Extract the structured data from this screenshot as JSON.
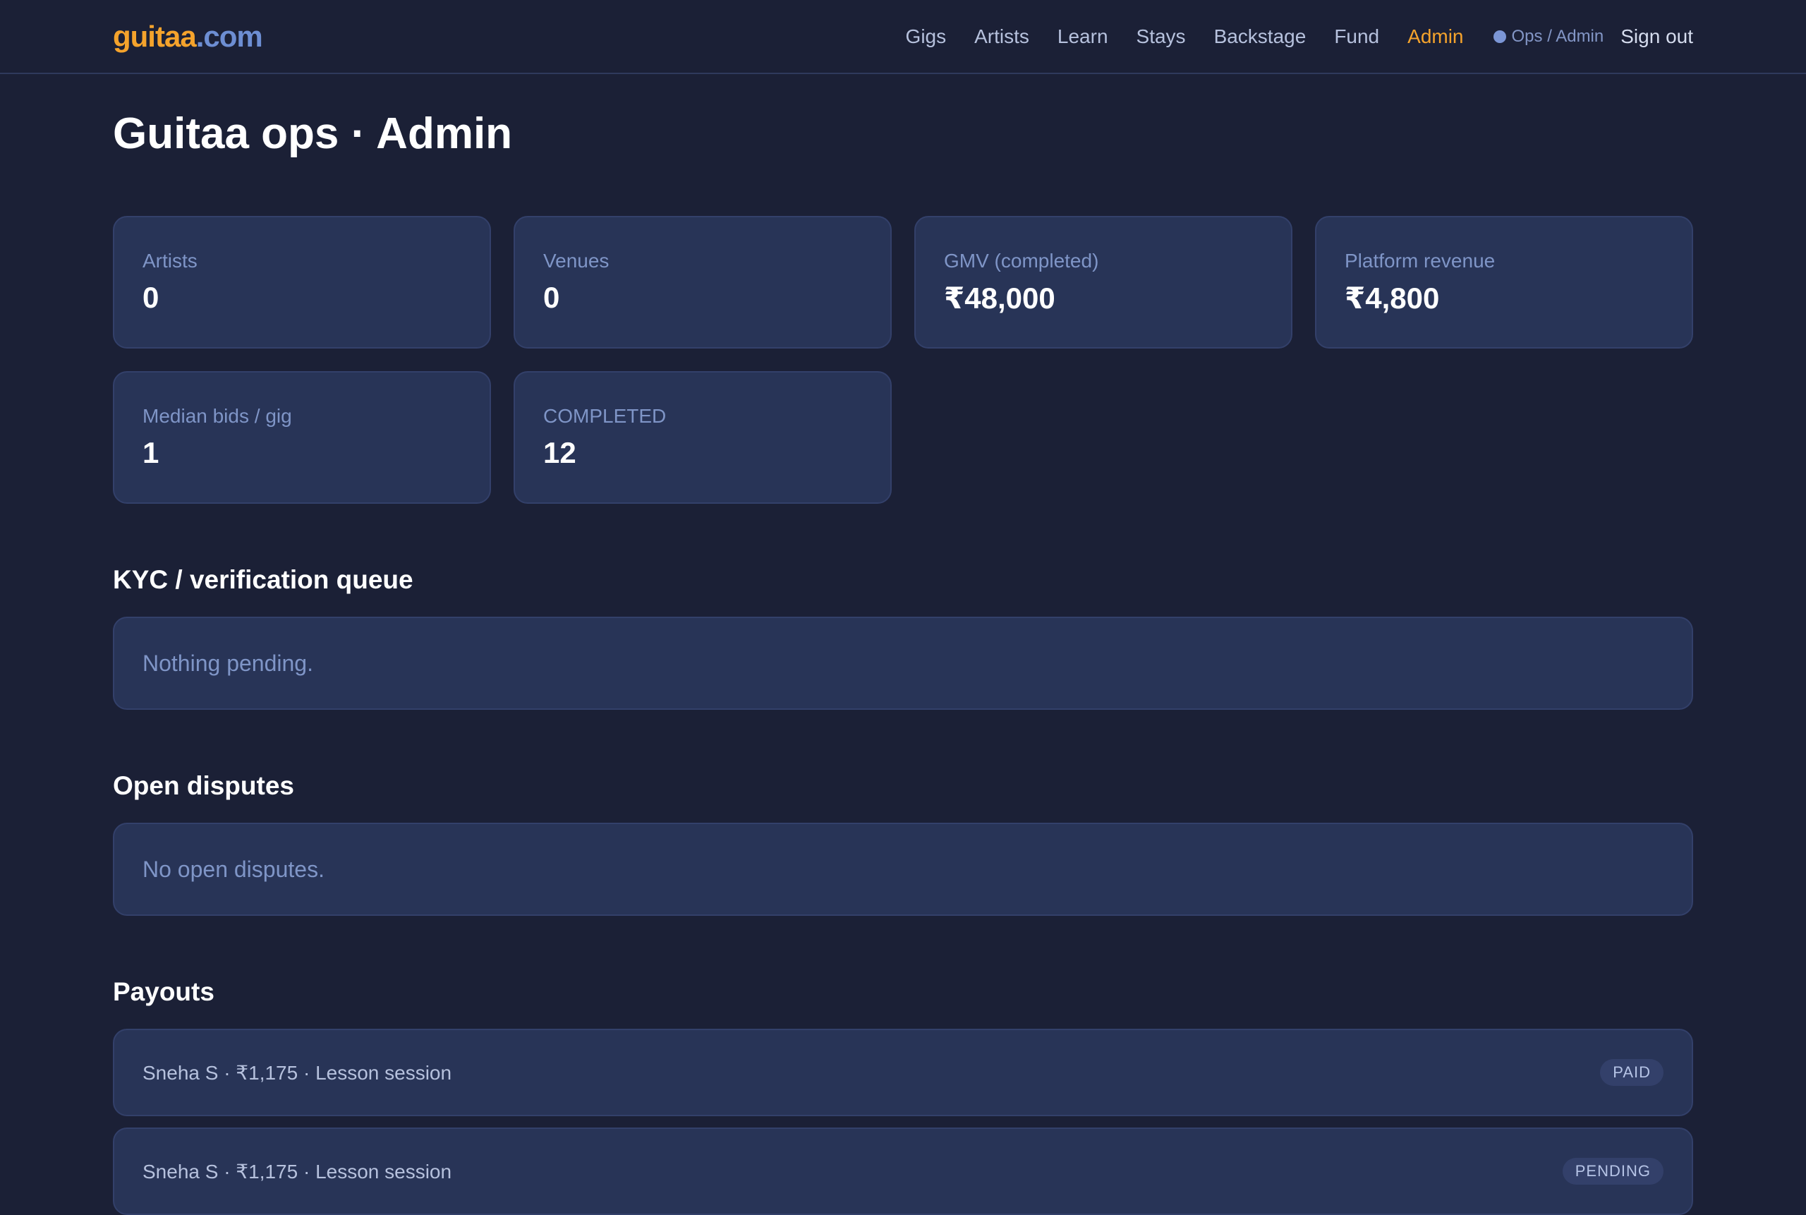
{
  "brand": {
    "part1": "guitaa",
    "part2": ".com"
  },
  "nav": {
    "links": [
      "Gigs",
      "Artists",
      "Learn",
      "Stays",
      "Backstage",
      "Fund",
      "Admin"
    ],
    "role": "Ops / Admin",
    "signout": "Sign out"
  },
  "page": {
    "title": "Guitaa ops · Admin"
  },
  "stats": [
    {
      "label": "Artists",
      "value": "0"
    },
    {
      "label": "Venues",
      "value": "0"
    },
    {
      "label": "GMV (completed)",
      "value": "₹48,000"
    },
    {
      "label": "Platform revenue",
      "value": "₹4,800"
    },
    {
      "label": "Median bids / gig",
      "value": "1"
    },
    {
      "label": "COMPLETED",
      "value": "12"
    }
  ],
  "kyc": {
    "title": "KYC / verification queue",
    "empty": "Nothing pending."
  },
  "disputes": {
    "title": "Open disputes",
    "empty": "No open disputes."
  },
  "payouts": {
    "title": "Payouts",
    "items": [
      {
        "text": "Sneha S · ₹1,175 · Lesson session",
        "status": "PAID"
      },
      {
        "text": "Sneha S · ₹1,175 · Lesson session",
        "status": "PENDING"
      }
    ]
  },
  "colors": {
    "background": "#1b2036",
    "card": "#283457",
    "accent": "#f5a32c",
    "brand_secondary": "#6d8ed3",
    "muted_text": "#7f95c7"
  }
}
